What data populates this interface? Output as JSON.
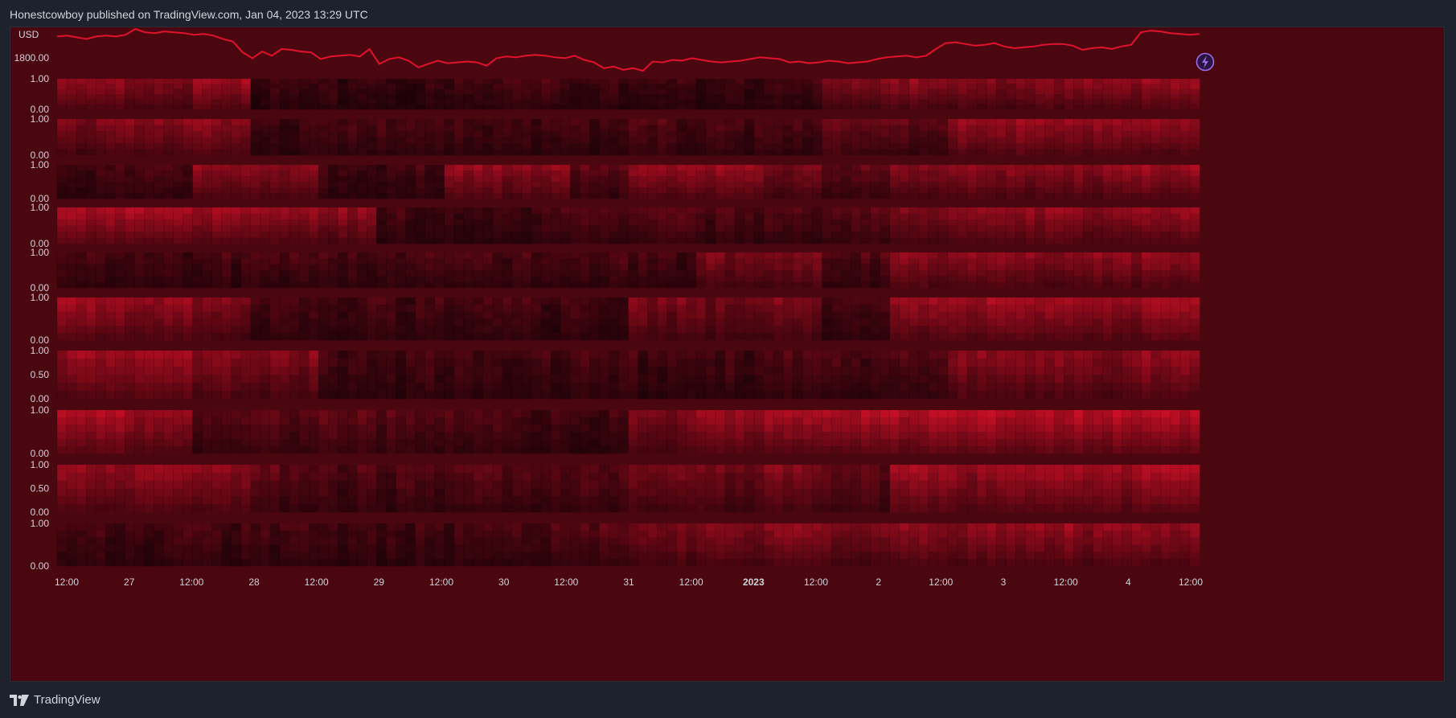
{
  "header": {
    "publisher_line": "Honestcowboy published on TradingView.com, Jan 04, 2023 13:29 UTC"
  },
  "footer": {
    "brand": "TradingView",
    "logo_icon": "tradingview-logo-icon"
  },
  "colors": {
    "background": "#1e222d",
    "chart_background": "#4a0710",
    "price_line": "#e2122d",
    "heat_low": "#1c0208",
    "heat_high": "#e4112a",
    "text": "#d1d4dc",
    "flash_icon": "#9c6cf0"
  },
  "chart_data": {
    "type": "heatmap",
    "price_panel": {
      "type": "line",
      "unit_label": "USD",
      "tick_label": "1800.00",
      "y_range": [
        1799,
        1850
      ],
      "series": {
        "values": [
          1841,
          1842,
          1840,
          1838,
          1841,
          1842,
          1841,
          1843,
          1850,
          1846,
          1845,
          1847,
          1846,
          1845,
          1843,
          1844,
          1842,
          1838,
          1835,
          1822,
          1815,
          1823,
          1818,
          1826,
          1825,
          1823,
          1822,
          1814,
          1817,
          1818,
          1819,
          1817,
          1826,
          1808,
          1814,
          1816,
          1812,
          1804,
          1808,
          1812,
          1809,
          1810,
          1811,
          1810,
          1806,
          1815,
          1817,
          1816,
          1818,
          1819,
          1818,
          1816,
          1815,
          1818,
          1813,
          1810,
          1803,
          1805,
          1801,
          1803,
          1800,
          1811,
          1810,
          1813,
          1812,
          1815,
          1813,
          1811,
          1810,
          1811,
          1812,
          1814,
          1816,
          1815,
          1814,
          1810,
          1811,
          1809,
          1810,
          1812,
          1811,
          1809,
          1810,
          1811,
          1814,
          1816,
          1817,
          1818,
          1816,
          1818,
          1826,
          1833,
          1834,
          1832,
          1830,
          1831,
          1833,
          1829,
          1827,
          1828,
          1829,
          1831,
          1832,
          1832,
          1830,
          1825,
          1827,
          1828,
          1826,
          1829,
          1831,
          1846,
          1848,
          1847,
          1845,
          1844,
          1843,
          1844
        ]
      }
    },
    "heat_panels_count": 10,
    "y_tick_labels": [
      [
        "1.00",
        "0.00"
      ],
      [
        "1.00",
        "0.00"
      ],
      [
        "1.00",
        "0.00"
      ],
      [
        "1.00",
        "0.00"
      ],
      [
        "1.00",
        "0.00"
      ],
      [
        "1.00",
        "0.00"
      ],
      [
        "1.00",
        "0.50",
        "0.00"
      ],
      [
        "1.00",
        "0.00"
      ],
      [
        "1.00",
        "0.50",
        "0.00"
      ],
      [
        "1.00",
        "0.00"
      ]
    ],
    "x_tick_labels": [
      "12:00",
      "27",
      "12:00",
      "28",
      "12:00",
      "29",
      "12:00",
      "30",
      "12:00",
      "31",
      "12:00",
      "2023",
      "12:00",
      "2",
      "12:00",
      "3",
      "12:00",
      "4",
      "12:00"
    ],
    "x_range": [
      "Dec 26 12:00",
      "Jan 04 12:00"
    ]
  }
}
